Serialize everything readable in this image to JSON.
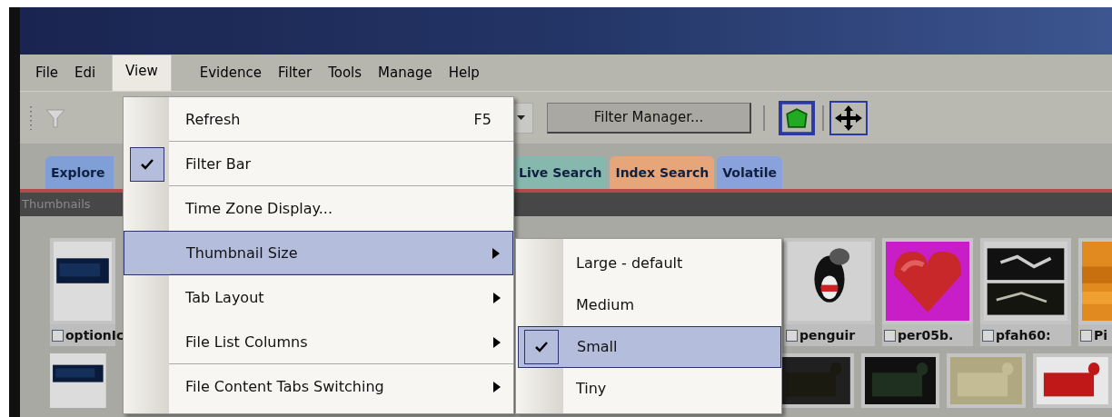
{
  "menu_bar": [
    {
      "label": "File",
      "open": false
    },
    {
      "label": "Edi",
      "open": false
    },
    {
      "label": "View",
      "open": true
    },
    {
      "label": "Evidence",
      "open": false
    },
    {
      "label": "Filter",
      "open": false
    },
    {
      "label": "Tools",
      "open": false
    },
    {
      "label": "Manage",
      "open": false
    },
    {
      "label": "Help",
      "open": false
    }
  ],
  "toolbar": {
    "filter_manager_button": "Filter Manager..."
  },
  "tabs": [
    {
      "label": "Explore",
      "color": "#7f9fd6"
    },
    {
      "label": "Live Search",
      "color": "#86b8ae"
    },
    {
      "label": "Index Search",
      "color": "#e6a67a"
    },
    {
      "label": "Volatile",
      "color": "#8aa2dc"
    }
  ],
  "panel_title": "Thumbnails",
  "thumbnails": [
    {
      "caption": "optionIc",
      "checked": false
    },
    {
      "caption": "penguir",
      "checked": false
    },
    {
      "caption": "per05b.",
      "checked": false
    },
    {
      "caption": "pfah60:",
      "checked": false
    },
    {
      "caption": "Pi",
      "checked": false
    }
  ],
  "view_menu": [
    {
      "label": "Refresh",
      "shortcut": "F5",
      "checked": false,
      "submenu": false,
      "highlighted": false,
      "separator_after": true
    },
    {
      "label": "Filter Bar",
      "checked": true,
      "submenu": false,
      "highlighted": false,
      "separator_after": true
    },
    {
      "label": "Time Zone Display...",
      "checked": false,
      "submenu": false,
      "highlighted": false,
      "separator_after": false
    },
    {
      "label": "Thumbnail Size",
      "checked": false,
      "submenu": true,
      "highlighted": true,
      "separator_after": true
    },
    {
      "label": "Tab Layout",
      "checked": false,
      "submenu": true,
      "highlighted": false,
      "separator_after": false
    },
    {
      "label": "File List Columns",
      "checked": false,
      "submenu": true,
      "highlighted": false,
      "separator_after": true
    },
    {
      "label": "File Content Tabs Switching",
      "checked": false,
      "submenu": true,
      "highlighted": false,
      "separator_after": false
    }
  ],
  "thumbnail_size_menu": [
    {
      "label": "Large - default",
      "checked": false,
      "highlighted": false
    },
    {
      "label": "Medium",
      "checked": false,
      "highlighted": false
    },
    {
      "label": "Small",
      "checked": true,
      "highlighted": true
    },
    {
      "label": "Tiny",
      "checked": false,
      "highlighted": false
    }
  ]
}
